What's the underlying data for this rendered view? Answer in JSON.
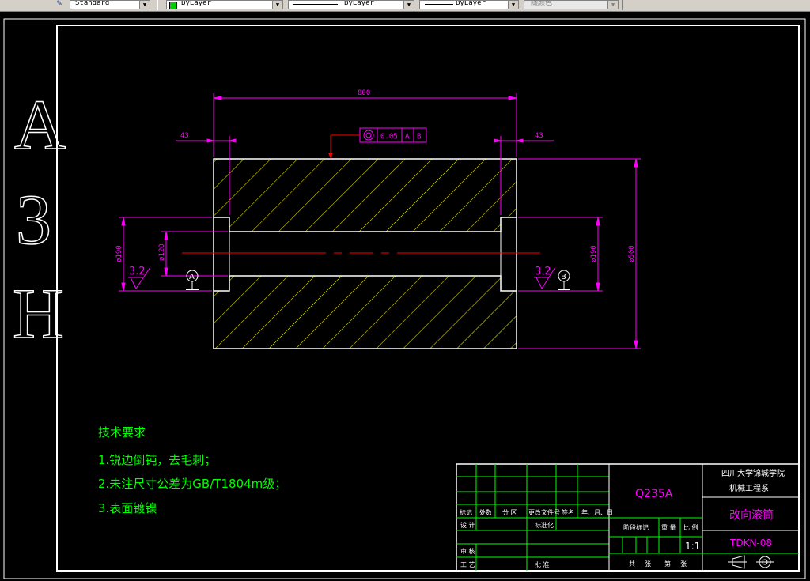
{
  "toolbar": {
    "text_style": "Standard",
    "layer_color": "ByLayer",
    "linetype": "ByLayer",
    "lineweight": "ByLayer",
    "plot_style": "随颜色",
    "layer_swatch_color": "#00cc00"
  },
  "sheet": {
    "size_mark": [
      "A",
      "3",
      "H"
    ]
  },
  "dimensions": {
    "overall_length": "800",
    "left_step": "43",
    "right_step": "43",
    "bore_left": "ø190",
    "shaft_left": "ø120",
    "bore_right": "ø190",
    "outer_diameter": "ø500"
  },
  "tolerance_frame": {
    "value": "0.05",
    "datum_1": "A",
    "datum_2": "B"
  },
  "datums": {
    "left": "A",
    "right": "B"
  },
  "roughness": {
    "left": "3.2",
    "right": "3.2"
  },
  "tech_requirements": {
    "title": "技术要求",
    "items": [
      "1.锐边倒钝，去毛刺；",
      "2.未注尺寸公差为GB/T1804m级；",
      "3.表面镀镍"
    ]
  },
  "title_block": {
    "material": "Q235A",
    "school": "四川大学锦城学院",
    "department": "机械工程系",
    "part_name": "改向滚筒",
    "drawing_no": "TDKN-08",
    "scale": "1:1",
    "labels": {
      "mark": "标记",
      "count": "处数",
      "zone": "分 区",
      "change_doc": "更改文件号",
      "signature": "签名",
      "date": "年、月、日",
      "design": "设 计",
      "standardize": "标准化",
      "review": "审 核",
      "process": "工 艺",
      "approve": "批 准",
      "stage_mark": "阶段标记",
      "weight": "重 量",
      "scale_label": "比 例",
      "total": "共",
      "sheet": "张",
      "page_no": "第",
      "page_sheet": "张"
    }
  },
  "colors": {
    "frame": "#ffffff",
    "dimension": "#ff00ff",
    "hatch": "#ffff00",
    "centerline": "#ff0000",
    "text": "#00ff00",
    "title_text": "#ff00ff"
  }
}
